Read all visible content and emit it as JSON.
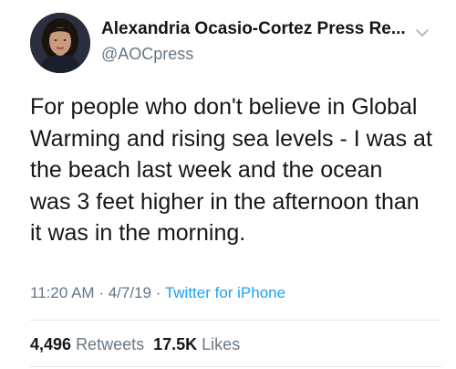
{
  "user": {
    "display_name": "Alexandria Ocasio-Cortez Press Re...",
    "handle": "@AOCpress"
  },
  "tweet": {
    "text": "For people who don't believe in Global\nWarming and rising sea levels - I was at\nthe beach last week and the ocean\nwas 3 feet higher in the afternoon than\nit was in the morning."
  },
  "meta": {
    "time": "11:20 AM",
    "separator": "·",
    "date": "4/7/19",
    "source": "Twitter for iPhone"
  },
  "stats": {
    "retweets_count": "4,496",
    "retweets_label": "Retweets",
    "likes_count": "17.5K",
    "likes_label": "Likes"
  },
  "colors": {
    "text": "#14171a",
    "secondary": "#657786",
    "link": "#1da1f2",
    "divider": "#e1e8ed"
  },
  "icons": {
    "more_menu": "chevron-down-icon"
  }
}
